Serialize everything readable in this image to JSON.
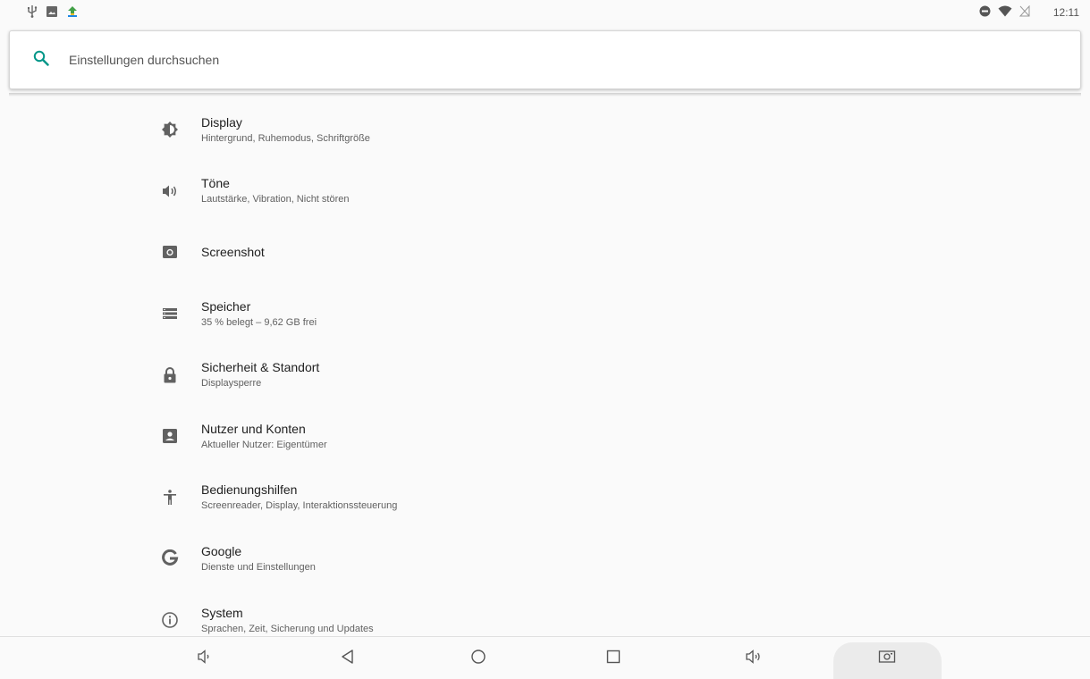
{
  "status_bar": {
    "time": "12:11",
    "left_icons": [
      "usb-icon",
      "image-icon",
      "app-notification-icon"
    ],
    "right_icons": [
      "do-not-disturb-icon",
      "wifi-icon",
      "no-sim-icon"
    ]
  },
  "search": {
    "placeholder": "Einstellungen durchsuchen",
    "icon": "search-icon"
  },
  "colors": {
    "accent": "#009688",
    "icon": "#616161",
    "background": "#fafafa"
  },
  "settings": {
    "items": [
      {
        "title": "Display",
        "subtitle": "Hintergrund, Ruhemodus, Schriftgröße",
        "icon": "brightness-icon"
      },
      {
        "title": "Töne",
        "subtitle": "Lautstärke, Vibration, Nicht stören",
        "icon": "volume-icon"
      },
      {
        "title": "Screenshot",
        "subtitle": "",
        "icon": "camera-icon"
      },
      {
        "title": "Speicher",
        "subtitle": "35 % belegt – 9,62 GB frei",
        "icon": "storage-icon"
      },
      {
        "title": "Sicherheit & Standort",
        "subtitle": "Displaysperre",
        "icon": "lock-icon"
      },
      {
        "title": "Nutzer und Konten",
        "subtitle": "Aktueller Nutzer: Eigentümer",
        "icon": "account-icon"
      },
      {
        "title": "Bedienungshilfen",
        "subtitle": "Screenreader, Display, Interaktionssteuerung",
        "icon": "accessibility-icon"
      },
      {
        "title": "Google",
        "subtitle": "Dienste und Einstellungen",
        "icon": "google-icon"
      },
      {
        "title": "System",
        "subtitle": "Sprachen, Zeit, Sicherung und Updates",
        "icon": "info-icon"
      }
    ]
  },
  "nav_bar": {
    "buttons": [
      "volume-down-icon",
      "back-icon",
      "home-icon",
      "recents-icon",
      "volume-up-icon",
      "screenshot-icon"
    ]
  }
}
